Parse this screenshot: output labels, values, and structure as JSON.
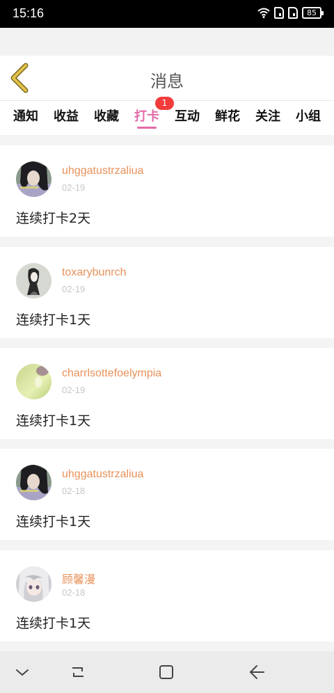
{
  "status_bar": {
    "time": "15:16",
    "battery": "85"
  },
  "header": {
    "title": "消息"
  },
  "tabs": [
    {
      "label": "通知"
    },
    {
      "label": "收益"
    },
    {
      "label": "收藏"
    },
    {
      "label": "打卡",
      "badge": "1"
    },
    {
      "label": "互动"
    },
    {
      "label": "鲜花"
    },
    {
      "label": "关注"
    },
    {
      "label": "小组"
    }
  ],
  "active_tab": "打卡",
  "messages": [
    {
      "username": "uhggatustrzaliua",
      "date": "02-19",
      "text": "连续打卡2天"
    },
    {
      "username": "toxarybunrch",
      "date": "02-19",
      "text": "连续打卡1天"
    },
    {
      "username": "charrlsottefoelympia",
      "date": "02-19",
      "text": "连续打卡1天"
    },
    {
      "username": "uhggatustrzaliua",
      "date": "02-18",
      "text": "连续打卡1天"
    },
    {
      "username": "顾馨漫",
      "date": "02-18",
      "text": "连续打卡1天"
    }
  ],
  "colors": {
    "accent": "#e26aa8",
    "username": "#e8915a",
    "badge": "#f23c3c",
    "back_arrow": "#e5c24a"
  },
  "nav_bar": {
    "icons": [
      "chevron-down-icon",
      "recent-apps-icon",
      "home-icon",
      "back-icon"
    ]
  }
}
